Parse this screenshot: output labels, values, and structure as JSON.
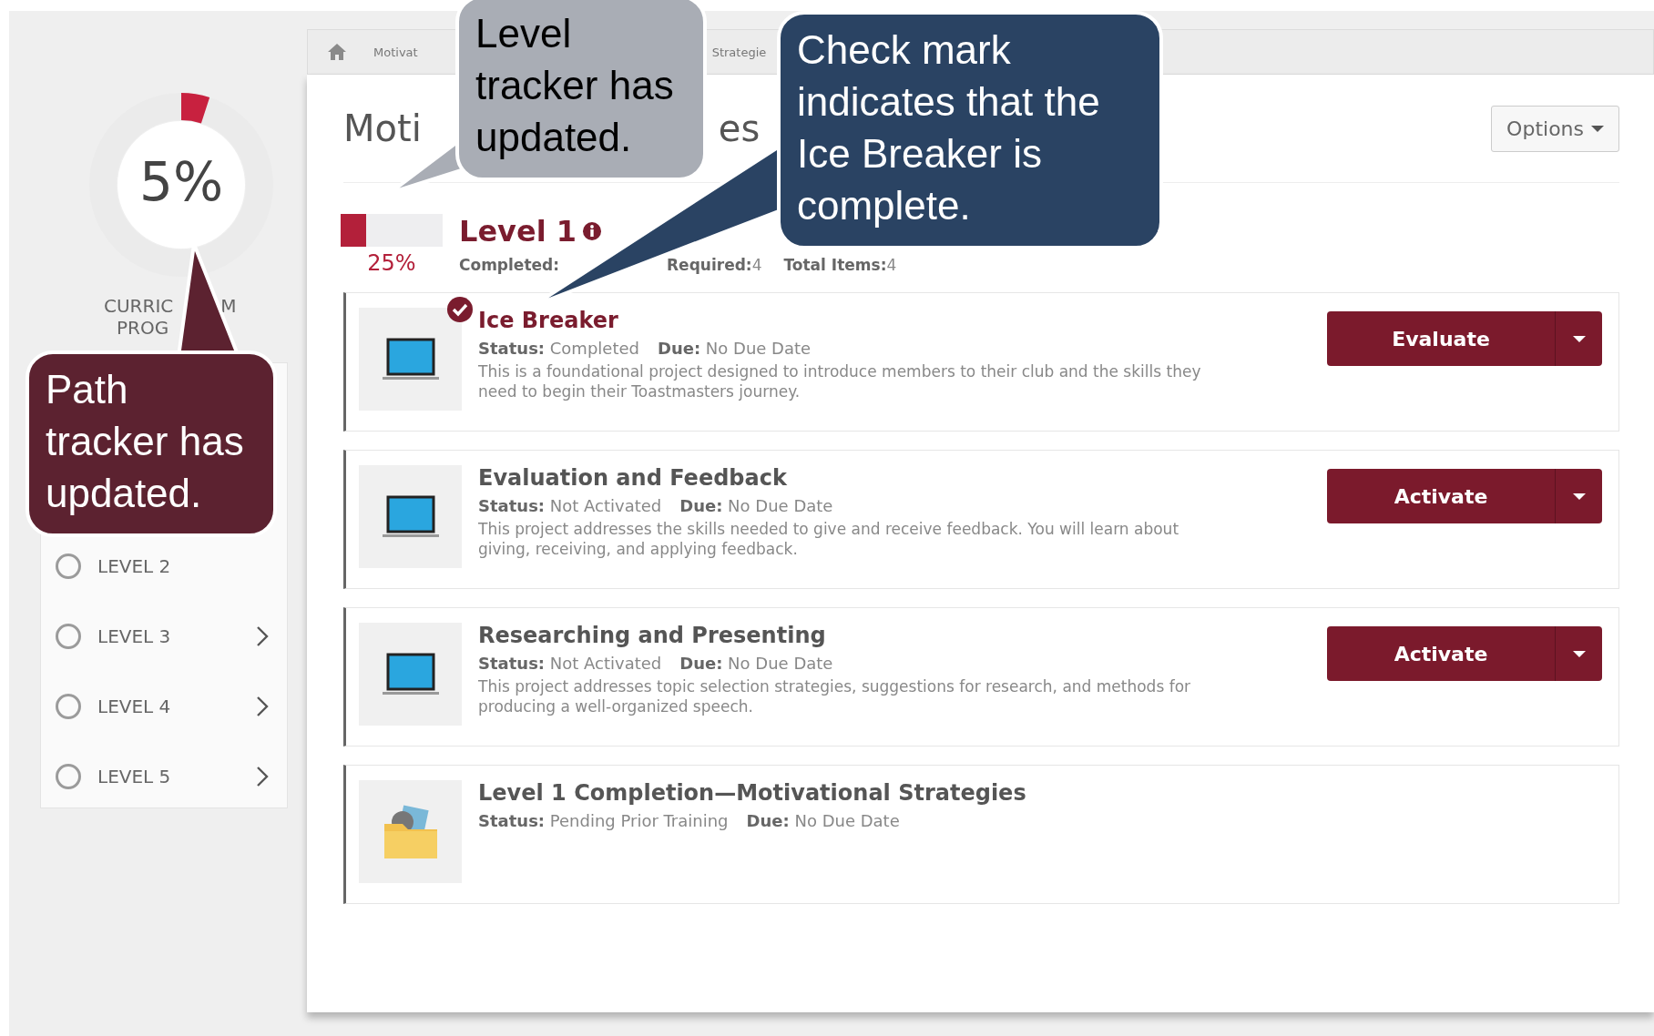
{
  "breadcrumb": {
    "items": [
      "Motivat",
      "Strategie"
    ]
  },
  "sidebar": {
    "progress": {
      "value": "5%",
      "level": 0.05
    },
    "caption": {
      "line_1": [
        "CURRIC",
        "M"
      ],
      "line_2": "PROG"
    },
    "levels": [
      {
        "label": "LEVEL 2",
        "expandable": false
      },
      {
        "label": "LEVEL 3",
        "expandable": true
      },
      {
        "label": "LEVEL 4",
        "expandable": true
      },
      {
        "label": "LEVEL 5",
        "expandable": true
      }
    ]
  },
  "header": {
    "title_fragments": [
      "Moti",
      "es"
    ],
    "options_button": "Options"
  },
  "level_summary": {
    "title": "Level 1",
    "level": 0.25,
    "percent": "25%",
    "stats": [
      {
        "label": "Completed:"
      },
      {
        "label": "Required:",
        "value": "4"
      },
      {
        "label": "Total Items:",
        "value": "4"
      }
    ]
  },
  "items": [
    {
      "kind": "laptop",
      "title": "Ice Breaker",
      "completed": true,
      "status_label": "Status:",
      "status": "Completed",
      "due_label": "Due:",
      "due": "No Due Date",
      "description": "This is a foundational project designed to introduce members to their club and the skills they need to begin their Toastmasters journey.",
      "action": "Evaluate"
    },
    {
      "kind": "laptop",
      "title": "Evaluation and Feedback",
      "completed": false,
      "status_label": "Status:",
      "status": "Not Activated",
      "due_label": "Due:",
      "due": "No Due Date",
      "description": "This project addresses the skills needed to give and receive feedback. You will learn about giving, receiving, and applying feedback.",
      "action": "Activate"
    },
    {
      "kind": "laptop",
      "title": "Researching and Presenting",
      "completed": false,
      "status_label": "Status:",
      "status": "Not Activated",
      "due_label": "Due:",
      "due": "No Due Date",
      "description": "This project addresses topic selection strategies, suggestions for research, and methods for producing a well-organized speech.",
      "action": "Activate"
    },
    {
      "kind": "folder",
      "title": "Level 1 Completion—Motivational Strategies",
      "completed": false,
      "status_label": "Status:",
      "status": "Pending Prior Training",
      "due_label": "Due:",
      "due": "No Due Date"
    }
  ],
  "callouts": [
    {
      "kind": "grey",
      "text": "Level tracker has updated."
    },
    {
      "kind": "navy",
      "text": "Check mark indicates that the Ice Breaker is complete."
    },
    {
      "kind": "maroon",
      "text": "Path tracker has updated."
    }
  ]
}
